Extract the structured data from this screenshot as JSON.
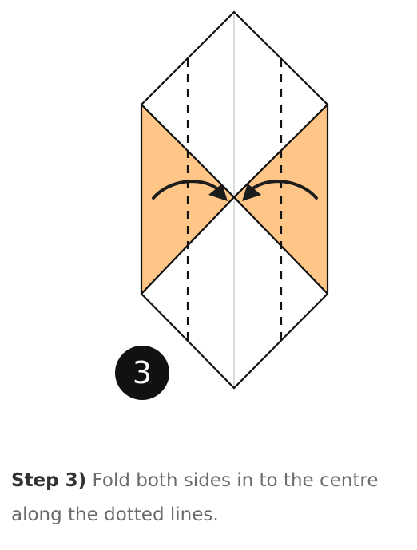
{
  "diagram": {
    "step_number": "3",
    "colors": {
      "paper_fill": "#ffffff",
      "flap_fill": "#ffc687",
      "outline": "#111111",
      "centre_crease": "#d9d9d9",
      "arrow": "#1c1c1c"
    },
    "icons": [
      "fold-in-arrow-left-icon",
      "fold-in-arrow-right-icon"
    ]
  },
  "caption": {
    "step_label": "Step 3)",
    "text": "Fold both sides in to the centre along the dotted lines."
  }
}
